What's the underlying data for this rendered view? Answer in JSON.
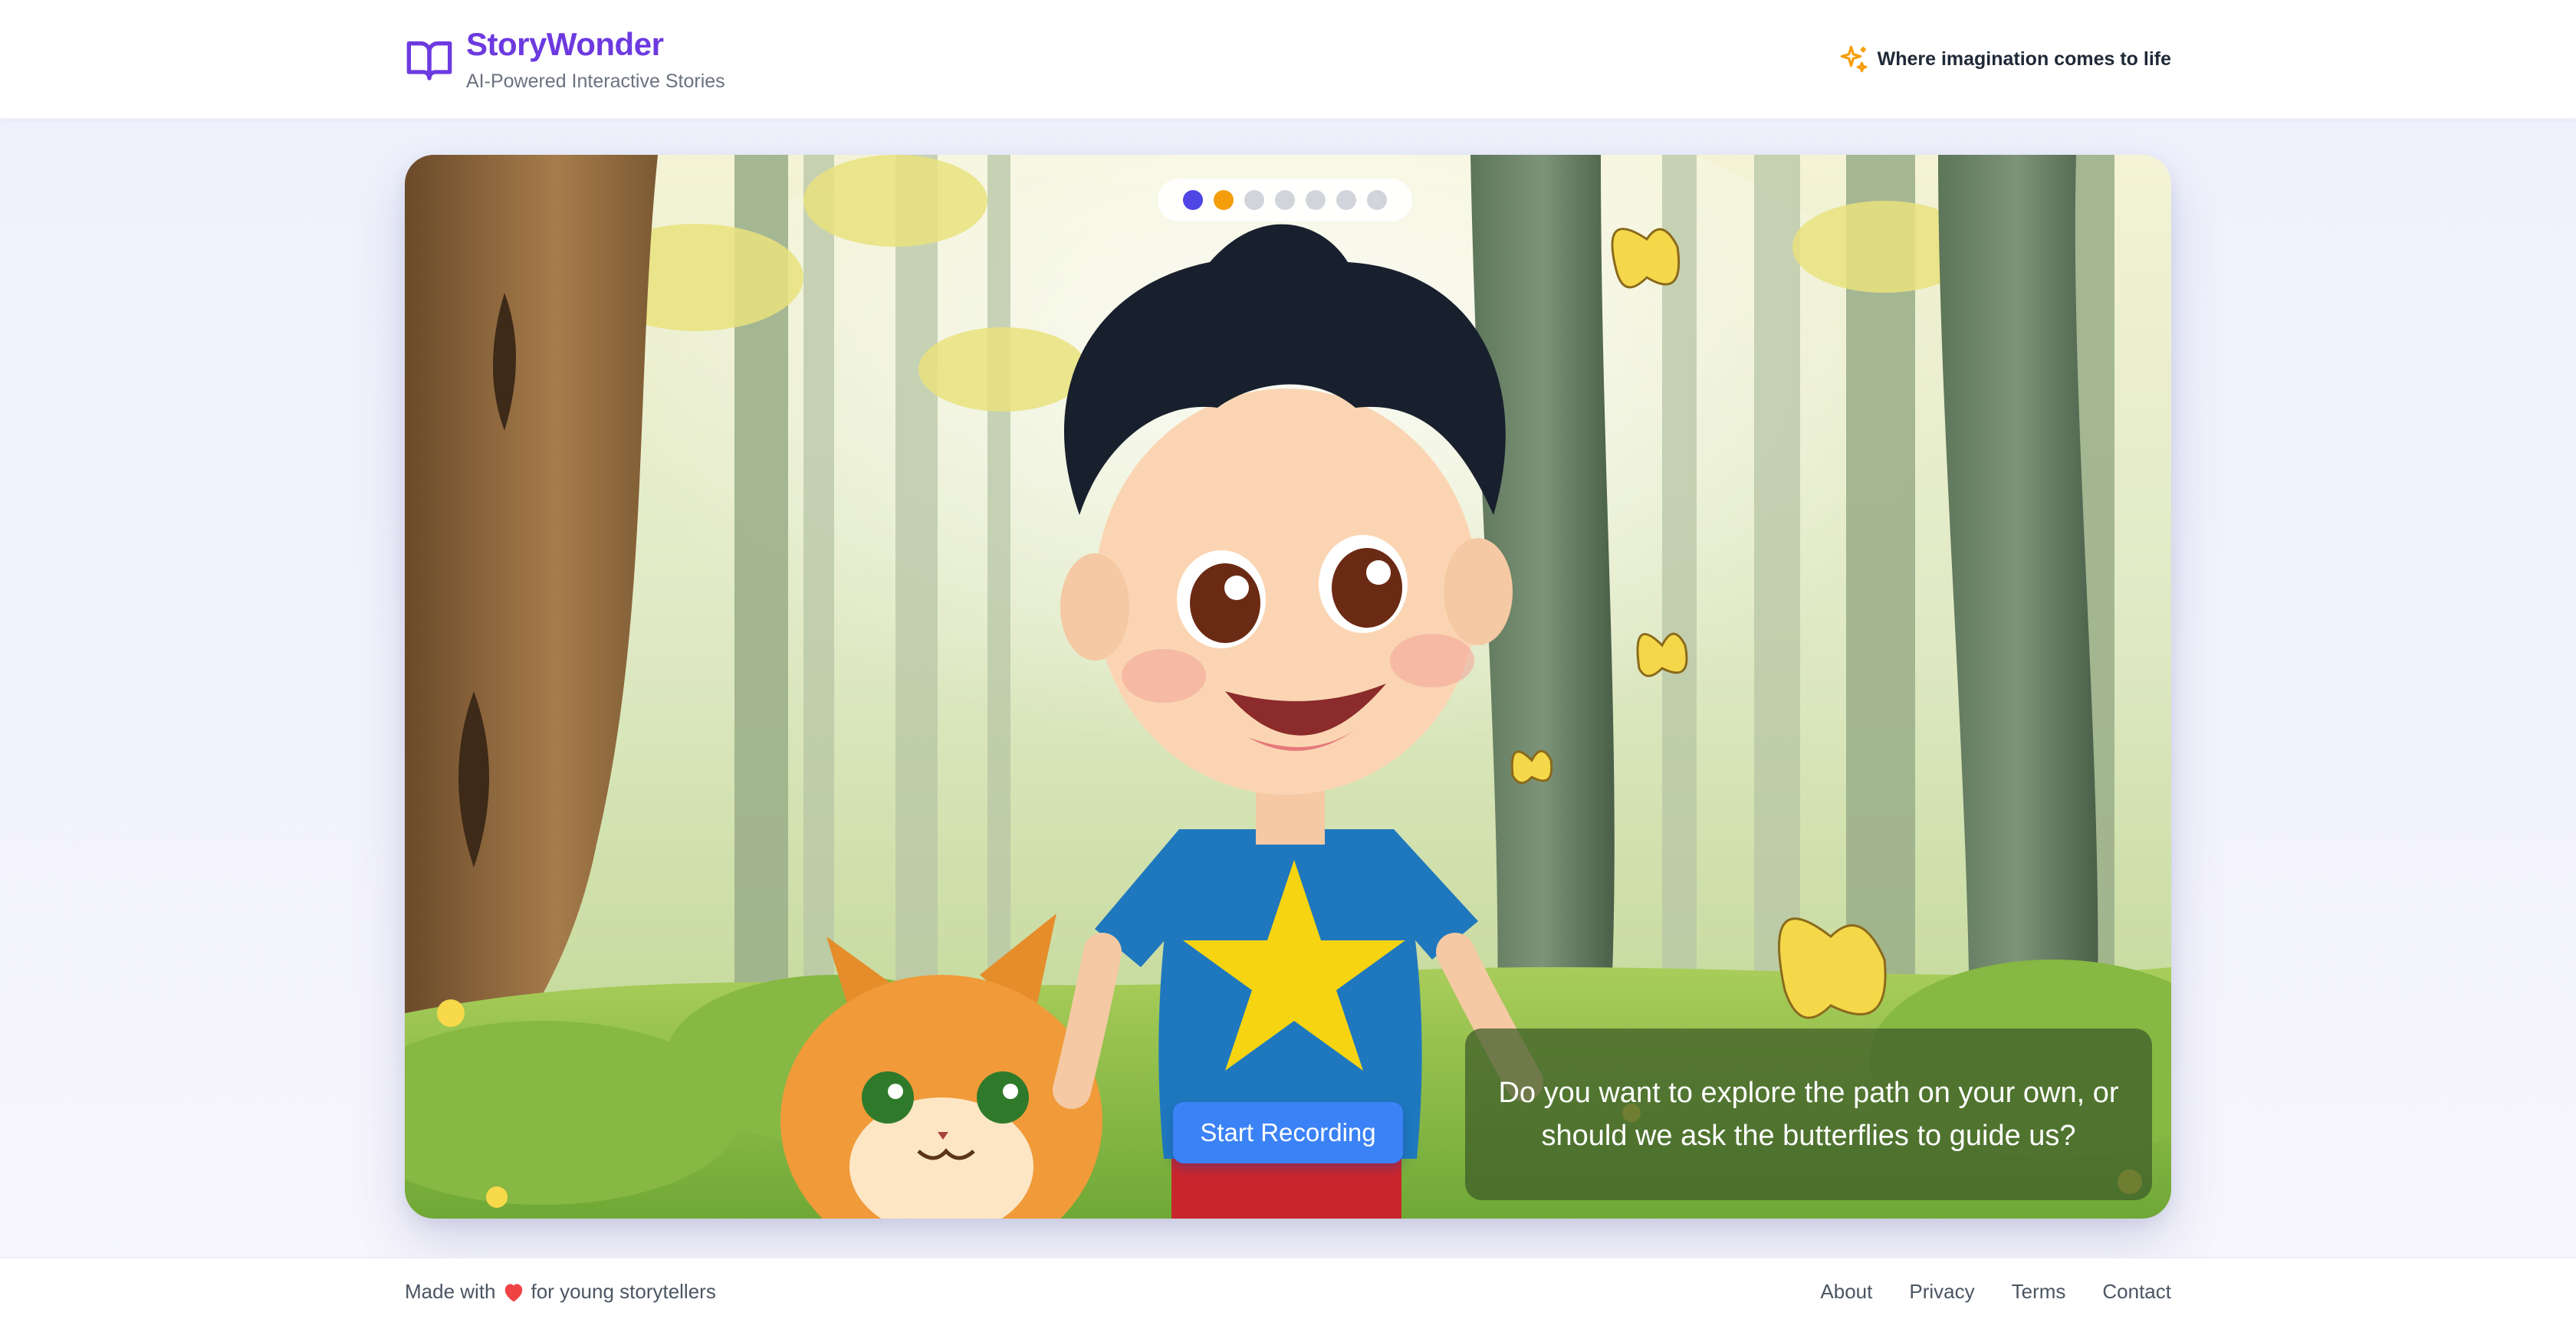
{
  "header": {
    "brand_name": "StoryWonder",
    "brand_tagline": "AI-Powered Interactive Stories",
    "tagline": "Where imagination comes to life",
    "logo_icon": "book-open-icon",
    "tagline_icon": "sparkles-icon"
  },
  "story": {
    "progress": {
      "total": 7,
      "current": 2,
      "completed": 1
    },
    "prompt": "Do you want to explore the path on your own, or should we ask the butterflies to guide us?",
    "record_button": "Start Recording",
    "scene": "illustration"
  },
  "footer": {
    "made_with_prefix": "Made with",
    "made_with_suffix": "for young storytellers",
    "links": [
      "About",
      "Privacy",
      "Terms",
      "Contact"
    ]
  },
  "colors": {
    "brand": "#6d3ae0",
    "accent": "#f59e0b",
    "button": "#3b82f6",
    "dot_done": "#4f46e5"
  }
}
